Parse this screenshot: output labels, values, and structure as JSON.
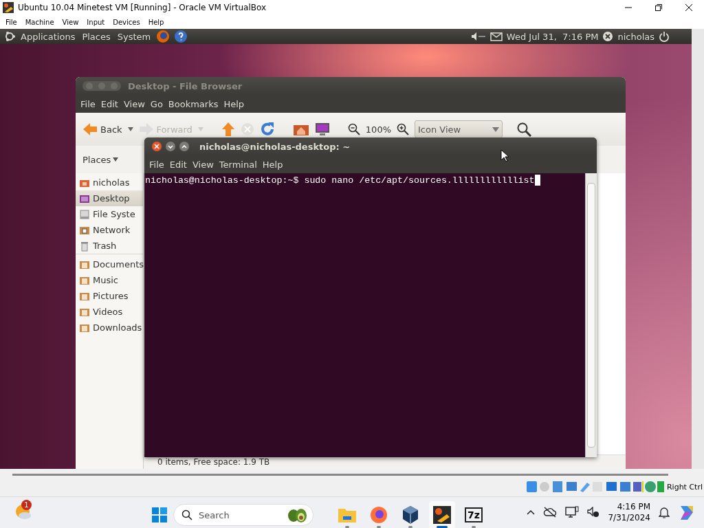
{
  "host_window": {
    "title": "Ubuntu 10.04 Minetest VM [Running] - Oracle VM VirtualBox",
    "menu": [
      "File",
      "Machine",
      "View",
      "Input",
      "Devices",
      "Help"
    ]
  },
  "ubuntu_panel": {
    "menus": [
      "Applications",
      "Places",
      "System"
    ],
    "clock": "Wed Jul 31,  7:16 PM",
    "user": "nicholas"
  },
  "file_browser": {
    "title": "Desktop - File Browser",
    "menu": [
      "File",
      "Edit",
      "View",
      "Go",
      "Bookmarks",
      "Help"
    ],
    "nav": [
      {
        "kind": "back",
        "label": "Back",
        "disabled": false
      },
      {
        "kind": "forward",
        "label": "Forward",
        "disabled": true
      }
    ],
    "zoom": "100%",
    "view_mode": "Icon View",
    "places_label": "Places",
    "places": [
      {
        "label": "nicholas",
        "selected": false,
        "kind": "home"
      },
      {
        "label": "Desktop",
        "selected": true,
        "kind": "desktop"
      },
      {
        "label": "File Syste",
        "selected": false,
        "kind": "drive"
      },
      {
        "label": "Network",
        "selected": false,
        "kind": "network"
      },
      {
        "label": "Trash",
        "selected": false,
        "kind": "trash"
      },
      {
        "label": "Documents",
        "selected": false,
        "kind": "folder",
        "group_start": true
      },
      {
        "label": "Music",
        "selected": false,
        "kind": "folder"
      },
      {
        "label": "Pictures",
        "selected": false,
        "kind": "folder"
      },
      {
        "label": "Videos",
        "selected": false,
        "kind": "folder"
      },
      {
        "label": "Downloads",
        "selected": false,
        "kind": "folder"
      }
    ],
    "status": "0 items, Free space: 1.9 TB"
  },
  "terminal": {
    "title": "nicholas@nicholas-desktop: ~",
    "menu": [
      "File",
      "Edit",
      "View",
      "Terminal",
      "Help"
    ],
    "lines": [
      "nicholas@nicholas-desktop:~$ sudo nano /etc/apt/sources.llllllllllllist"
    ]
  },
  "vbox_status": {
    "host_key": "Right Ctrl"
  },
  "taskbar": {
    "weather_badge": "1",
    "search_placeholder": "Search",
    "apps": [
      {
        "kind": "files",
        "selected": false
      },
      {
        "kind": "firefox",
        "selected": false
      },
      {
        "kind": "cube",
        "selected": false
      },
      {
        "kind": "vbox",
        "selected": true
      },
      {
        "kind": "zip",
        "selected": false,
        "label": "7z"
      }
    ],
    "time": "4:16 PM",
    "date": "7/31/2024"
  }
}
